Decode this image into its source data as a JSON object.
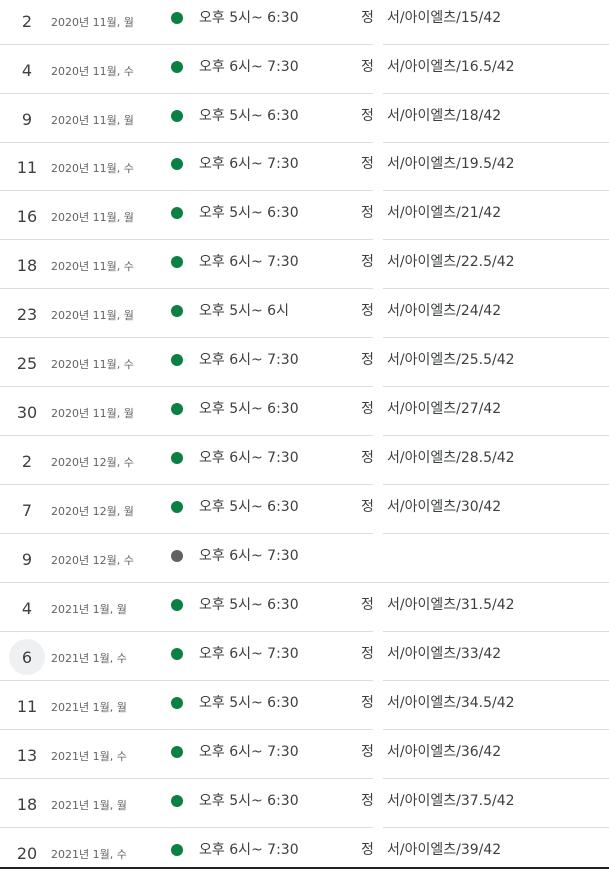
{
  "rows": [
    {
      "day": "2",
      "month": "2020년 11월, 월",
      "time": "오후 5시~ 6:30",
      "title_a": "정",
      "title_b": "서/아이엘츠/15/42",
      "dot": "#0b8043"
    },
    {
      "day": "4",
      "month": "2020년 11월, 수",
      "time": "오후 6시~ 7:30",
      "title_a": "정",
      "title_b": "서/아이엘츠/16.5/42",
      "dot": "#0b8043"
    },
    {
      "day": "9",
      "month": "2020년 11월, 월",
      "time": "오후 5시~ 6:30",
      "title_a": "정",
      "title_b": "서/아이엘츠/18/42",
      "dot": "#0b8043"
    },
    {
      "day": "11",
      "month": "2020년 11월, 수",
      "time": "오후 6시~ 7:30",
      "title_a": "정",
      "title_b": "서/아이엘츠/19.5/42",
      "dot": "#0b8043"
    },
    {
      "day": "16",
      "month": "2020년 11월, 월",
      "time": "오후 5시~ 6:30",
      "title_a": "정",
      "title_b": "서/아이엘츠/21/42",
      "dot": "#0b8043"
    },
    {
      "day": "18",
      "month": "2020년 11월, 수",
      "time": "오후 6시~ 7:30",
      "title_a": "정",
      "title_b": "서/아이엘츠/22.5/42",
      "dot": "#0b8043"
    },
    {
      "day": "23",
      "month": "2020년 11월, 월",
      "time": "오후 5시~ 6시",
      "title_a": "정",
      "title_b": "서/아이엘츠/24/42",
      "dot": "#0b8043"
    },
    {
      "day": "25",
      "month": "2020년 11월, 수",
      "time": "오후 6시~ 7:30",
      "title_a": "정",
      "title_b": "서/아이엘츠/25.5/42",
      "dot": "#0b8043"
    },
    {
      "day": "30",
      "month": "2020년 11월, 월",
      "time": "오후 5시~ 6:30",
      "title_a": "정",
      "title_b": "서/아이엘츠/27/42",
      "dot": "#0b8043"
    },
    {
      "day": "2",
      "month": "2020년 12월, 수",
      "time": "오후 6시~ 7:30",
      "title_a": "정",
      "title_b": "서/아이엘츠/28.5/42",
      "dot": "#0b8043"
    },
    {
      "day": "7",
      "month": "2020년 12월, 월",
      "time": "오후 5시~ 6:30",
      "title_a": "정",
      "title_b": "서/아이엘츠/30/42",
      "dot": "#0b8043"
    },
    {
      "day": "9",
      "month": "2020년 12월, 수",
      "time": "오후 6시~ 7:30",
      "title_a": "",
      "title_b": "",
      "dot": "#616161"
    },
    {
      "day": "4",
      "month": "2021년 1월, 월",
      "time": "오후 5시~ 6:30",
      "title_a": "정",
      "title_b": "서/아이엘츠/31.5/42",
      "dot": "#0b8043"
    },
    {
      "day": "6",
      "month": "2021년 1월, 수",
      "time": "오후 6시~ 7:30",
      "title_a": "정",
      "title_b": "서/아이엘츠/33/42",
      "dot": "#0b8043",
      "today": true
    },
    {
      "day": "11",
      "month": "2021년 1월, 월",
      "time": "오후 5시~ 6:30",
      "title_a": "정",
      "title_b": "서/아이엘츠/34.5/42",
      "dot": "#0b8043"
    },
    {
      "day": "13",
      "month": "2021년 1월, 수",
      "time": "오후 6시~ 7:30",
      "title_a": "정",
      "title_b": "서/아이엘츠/36/42",
      "dot": "#0b8043"
    },
    {
      "day": "18",
      "month": "2021년 1월, 월",
      "time": "오후 5시~ 6:30",
      "title_a": "정",
      "title_b": "서/아이엘츠/37.5/42",
      "dot": "#0b8043"
    },
    {
      "day": "20",
      "month": "2021년 1월, 수",
      "time": "오후 6시~ 7:30",
      "title_a": "정",
      "title_b": "서/아이엘츠/39/42",
      "dot": "#0b8043"
    }
  ]
}
